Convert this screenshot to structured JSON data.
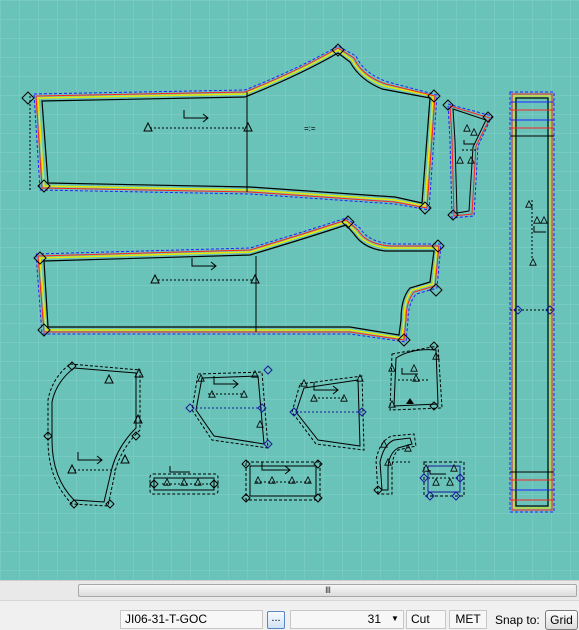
{
  "canvas": {
    "background_color": "#6ac3b9",
    "grid_color": "#7fd0c9",
    "piece_outline_color": "#000000",
    "seam_dash_color": "#1a1a9a",
    "pieces": [
      {
        "name": "front-panel-top"
      },
      {
        "name": "small-strap-piece"
      },
      {
        "name": "waistband-piece"
      },
      {
        "name": "back-panel"
      },
      {
        "name": "pocket-piece"
      },
      {
        "name": "yoke-piece-left"
      },
      {
        "name": "yoke-piece-right"
      },
      {
        "name": "fly-piece"
      },
      {
        "name": "belt-loop-piece"
      },
      {
        "name": "facing-piece"
      },
      {
        "name": "curved-facing-piece"
      },
      {
        "name": "small-tab-piece"
      },
      {
        "name": "rectangle-tab-piece"
      }
    ]
  },
  "scrollbar": {
    "grip": "III"
  },
  "statusbar": {
    "file_name": "JI06-31-T-GOC",
    "browse_label": "...",
    "size_value": "31",
    "mode": "Cut",
    "units": "MET",
    "snap_label": "Snap to:",
    "snap_value": "Grid"
  }
}
